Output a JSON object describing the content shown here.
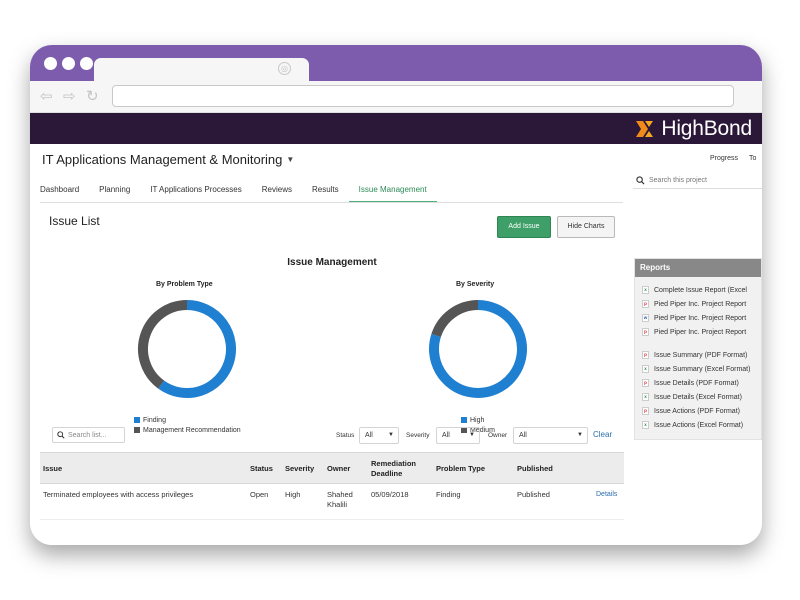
{
  "app": {
    "brand_name": "HighBond",
    "brand_color": "#2b1737",
    "accent_color": "#f08a1a",
    "titlebar_color": "#7d5cad"
  },
  "browser": {
    "nav_icons": [
      "back-arrow-icon",
      "forward-arrow-icon",
      "refresh-icon"
    ],
    "tab_icon": "globe-icon"
  },
  "header": {
    "project_title": "IT Applications Management & Monitoring",
    "links": [
      "Progress",
      "To"
    ],
    "search_placeholder": "Search this project"
  },
  "tabs": [
    {
      "label": "Dashboard",
      "active": false
    },
    {
      "label": "Planning",
      "active": false
    },
    {
      "label": "IT Applications Processes",
      "active": false
    },
    {
      "label": "Reviews",
      "active": false
    },
    {
      "label": "Results",
      "active": false
    },
    {
      "label": "Issue Management",
      "active": true
    }
  ],
  "main": {
    "title": "Issue List",
    "add_button": "Add Issue",
    "hide_button": "Hide Charts",
    "chart_heading": "Issue Management"
  },
  "chart_data": [
    {
      "type": "pie",
      "title": "By Problem Type",
      "categories": [
        "Finding",
        "Management Recommendation"
      ],
      "values": [
        60,
        40
      ],
      "colors": [
        "#1f7fd0",
        "#555555"
      ],
      "legend_position": "bottom-left"
    },
    {
      "type": "pie",
      "title": "By Severity",
      "categories": [
        "High",
        "Medium"
      ],
      "values": [
        80,
        20
      ],
      "colors": [
        "#1f7fd0",
        "#555555"
      ],
      "legend_position": "bottom-left"
    }
  ],
  "filters": {
    "search_placeholder": "Search list...",
    "status_label": "Status",
    "status_value": "All",
    "severity_label": "Severity",
    "severity_value": "All",
    "owner_label": "Owner",
    "owner_value": "All",
    "clear_label": "Clear"
  },
  "table": {
    "headers": [
      "Issue",
      "Status",
      "Severity",
      "Owner",
      "Remediation Deadline",
      "Problem Type",
      "Published"
    ],
    "rows": [
      {
        "issue": "Terminated employees with access privileges",
        "status": "Open",
        "severity": "High",
        "owner": "Shahed Khalili",
        "deadline": "05/09/2018",
        "problem_type": "Finding",
        "published": "Published",
        "action": "Details"
      }
    ]
  },
  "reports": {
    "title": "Reports",
    "group1": [
      {
        "label": "Complete Issue Report (Excel",
        "icon": "excel-file-icon"
      },
      {
        "label": "Pied Piper Inc. Project Report",
        "icon": "pdf-file-icon"
      },
      {
        "label": "Pied Piper Inc. Project Report",
        "icon": "word-file-icon"
      },
      {
        "label": "Pied Piper Inc. Project Report",
        "icon": "pdf-file-icon"
      }
    ],
    "group2": [
      {
        "label": "Issue Summary (PDF Format)",
        "icon": "pdf-file-icon"
      },
      {
        "label": "Issue Summary (Excel Format)",
        "icon": "excel-file-icon"
      },
      {
        "label": "Issue Details (PDF Format)",
        "icon": "pdf-file-icon"
      },
      {
        "label": "Issue Details (Excel Format)",
        "icon": "excel-file-icon"
      },
      {
        "label": "Issue Actions (PDF Format)",
        "icon": "pdf-file-icon"
      },
      {
        "label": "Issue Actions (Excel Format)",
        "icon": "excel-file-icon"
      }
    ]
  }
}
